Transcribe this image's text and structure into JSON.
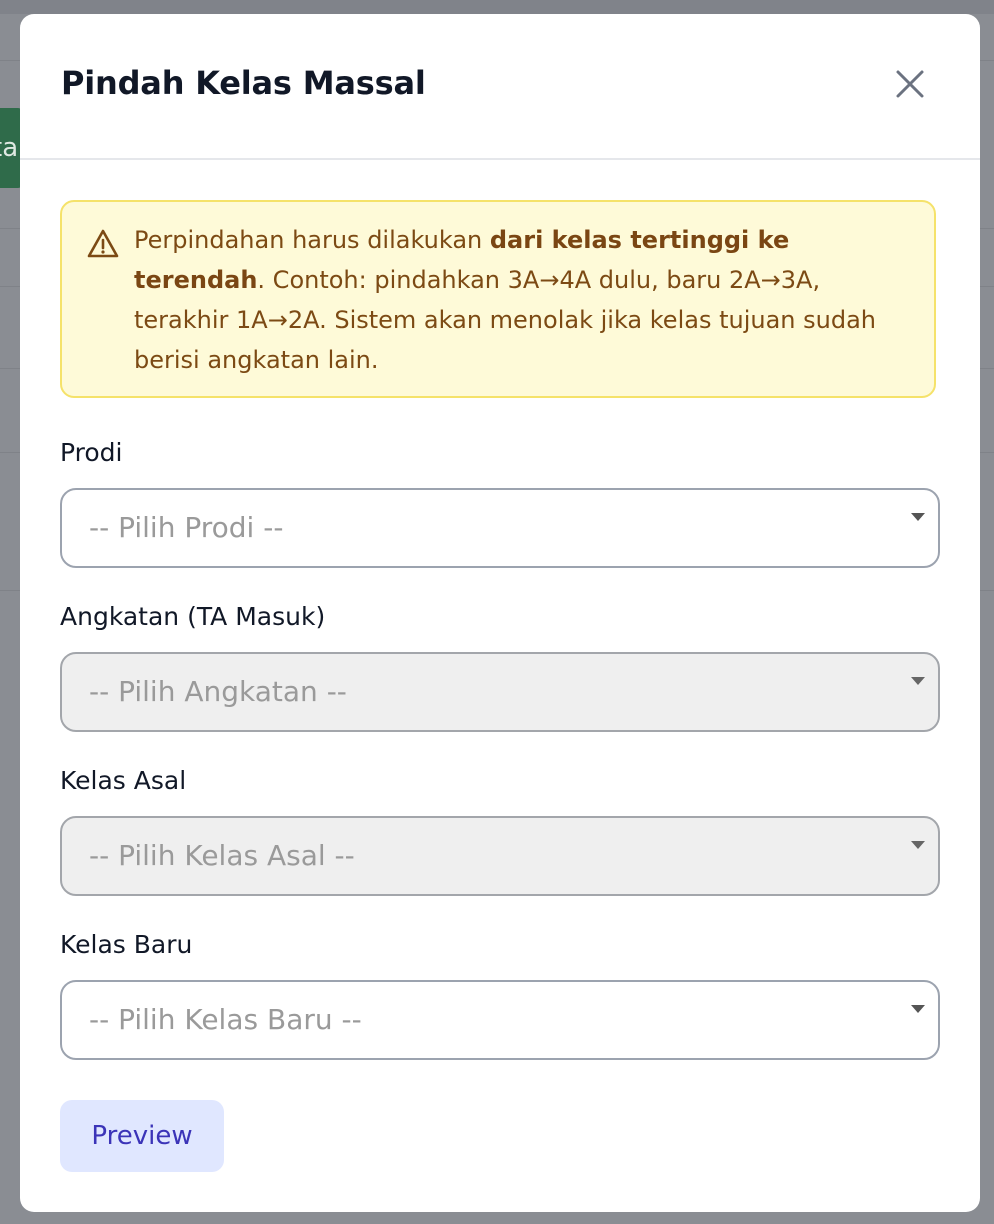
{
  "background": {
    "partial_button_text": "ta"
  },
  "modal": {
    "title": "Pindah Kelas Massal",
    "close_icon": "close-icon"
  },
  "alert": {
    "icon": "warning-triangle-icon",
    "text_before": "Perpindahan harus dilakukan ",
    "text_bold": "dari kelas tertinggi ke terendah",
    "text_after": ". Contoh: pindahkan 3A→4A dulu, baru 2A→3A, terakhir 1A→2A. Sistem akan menolak jika kelas tujuan sudah berisi angkatan lain.",
    "colors": {
      "background": "#fefad8",
      "border": "#f5e26a",
      "text": "#7c4a14"
    }
  },
  "form": {
    "prodi": {
      "label": "Prodi",
      "placeholder": "-- Pilih Prodi --",
      "disabled": false
    },
    "angkatan": {
      "label": "Angkatan (TA Masuk)",
      "placeholder": "-- Pilih Angkatan --",
      "disabled": true
    },
    "kelas_asal": {
      "label": "Kelas Asal",
      "placeholder": "-- Pilih Kelas Asal --",
      "disabled": true
    },
    "kelas_baru": {
      "label": "Kelas Baru",
      "placeholder": "-- Pilih Kelas Baru --",
      "disabled": false
    }
  },
  "actions": {
    "preview_label": "Preview",
    "colors": {
      "background": "#e0e7ff",
      "text": "#3b34b8"
    }
  }
}
